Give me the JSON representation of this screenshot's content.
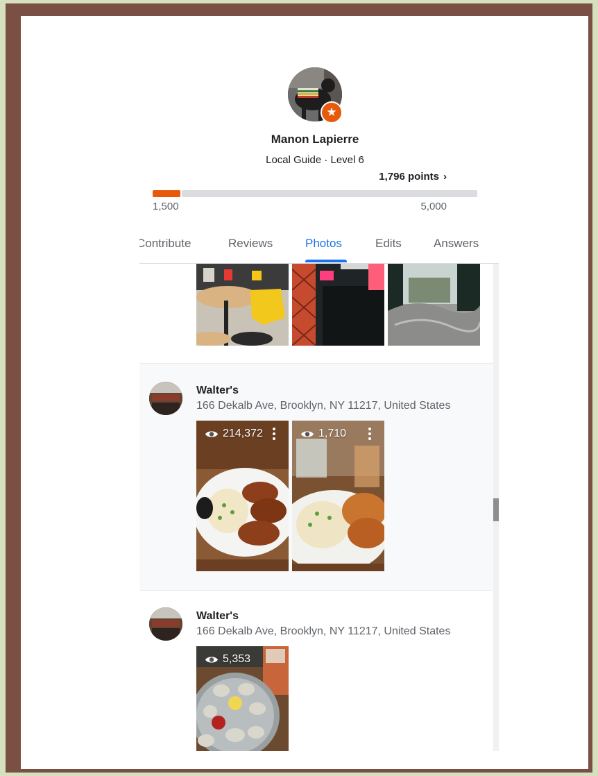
{
  "profile": {
    "name": "Manon Lapierre",
    "level": "Local Guide · Level 6",
    "points": "1,796 points",
    "progress_min": "1,500",
    "progress_max": "5,000",
    "progress_current": 1796,
    "progress_range": [
      1500,
      5000
    ]
  },
  "tabs": [
    {
      "label": "Contribute",
      "active": false
    },
    {
      "label": "Reviews",
      "active": false
    },
    {
      "label": "Photos",
      "active": true
    },
    {
      "label": "Edits",
      "active": false
    },
    {
      "label": "Answers",
      "active": false
    }
  ],
  "places": [
    {
      "name": "Walter's",
      "address": "166 Dekalb Ave, Brooklyn, NY 11217, United States",
      "photos": [
        {
          "views": "214,372"
        },
        {
          "views": "1,710"
        }
      ]
    },
    {
      "name": "Walter's",
      "address": "166 Dekalb Ave, Brooklyn, NY 11217, United States",
      "photos": [
        {
          "views": "5,353"
        }
      ]
    }
  ],
  "colors": {
    "accent_blue": "#1a73e8",
    "guide_orange": "#e8590c",
    "frame_brown": "#7a4f44",
    "outer_green": "#d6e0bf"
  },
  "icons": {
    "badge": "star-icon",
    "views": "eye-icon",
    "menu": "more-vert-icon",
    "points": "chevron-right-icon"
  }
}
